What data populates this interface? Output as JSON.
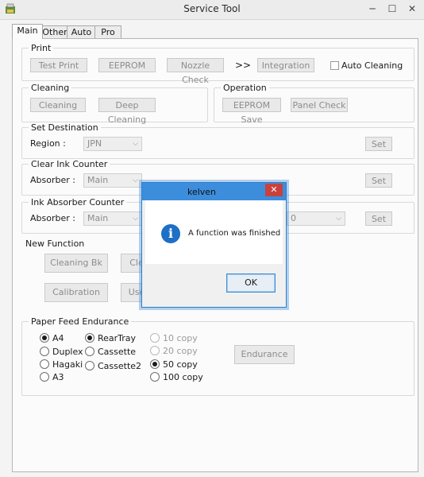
{
  "window": {
    "title": "Service Tool"
  },
  "tabs": [
    "Main",
    "Other",
    "Auto",
    "Pro"
  ],
  "print": {
    "label": "Print",
    "test_print": "Test Print",
    "eeprom": "EEPROM",
    "nozzle_check": "Nozzle Check",
    "arrows": ">>",
    "integration": "Integration",
    "auto_cleaning": "Auto Cleaning"
  },
  "cleaning": {
    "label": "Cleaning",
    "cleaning": "Cleaning",
    "deep_cleaning": "Deep Cleaning"
  },
  "operation": {
    "label": "Operation",
    "eeprom_save": "EEPROM Save",
    "panel_check": "Panel Check"
  },
  "set_destination": {
    "label": "Set Destination",
    "region_label": "Region :",
    "region_value": "JPN",
    "set": "Set"
  },
  "clear_ink_counter": {
    "label": "Clear Ink Counter",
    "absorber_label": "Absorber :",
    "absorber_value": "Main",
    "set": "Set"
  },
  "ink_absorber_counter": {
    "label": "Ink Absorber Counter",
    "absorber_label": "Absorber :",
    "absorber_value": "Main",
    "value": "0",
    "set": "Set"
  },
  "new_function": {
    "label": "New Function",
    "cleaning_bk": "Cleaning Bk",
    "cle_partial": "Cle",
    "calibration": "Calibration",
    "use_partial": "Use"
  },
  "paper_feed_endurance": {
    "label": "Paper Feed Endurance",
    "paper_sizes": [
      "A4",
      "Duplex",
      "Hagaki",
      "A3"
    ],
    "trays": [
      "RearTray",
      "Cassette",
      "Cassette2"
    ],
    "copies": [
      "10 copy",
      "20 copy",
      "50 copy",
      "100 copy"
    ],
    "endurance": "Endurance"
  },
  "dialog": {
    "title": "kelven",
    "close": "✕",
    "message": "A function was finished",
    "ok": "OK"
  }
}
